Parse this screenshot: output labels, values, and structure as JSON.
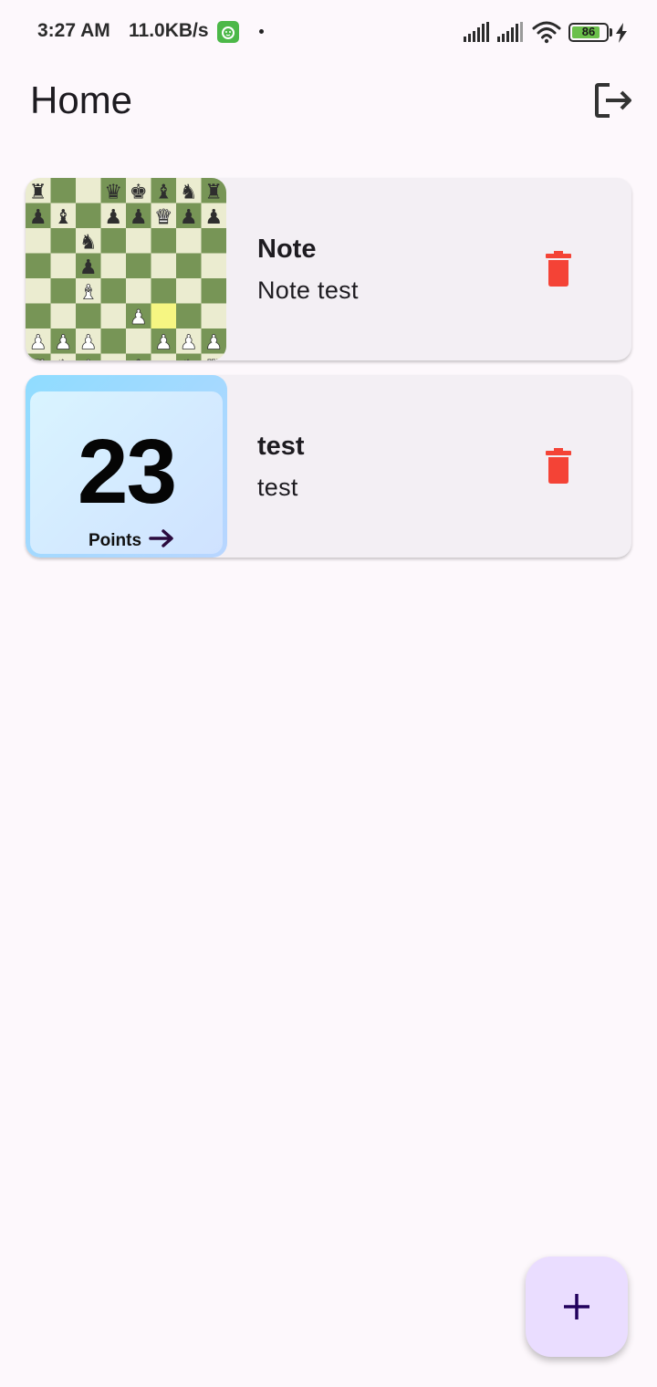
{
  "status_bar": {
    "time": "3:27 AM",
    "network_speed": "11.0KB/s",
    "battery": "86",
    "battery_level": 0.86,
    "icons": [
      "app-notification-icon",
      "dot-icon",
      "signal-icon",
      "signal-icon",
      "wifi-icon",
      "battery-icon",
      "charging-icon"
    ]
  },
  "app_bar": {
    "title": "Home",
    "logout_icon": "logout-icon"
  },
  "notes": [
    {
      "title": "Note",
      "subtitle": "Note test",
      "thumbnail": "chess-board",
      "delete_icon": "trash-icon"
    },
    {
      "title": "test",
      "subtitle": "test",
      "thumbnail": "points-card",
      "points_value": "23",
      "points_label": "Points",
      "delete_icon": "trash-icon"
    }
  ],
  "fab": {
    "icon": "plus-icon"
  },
  "colors": {
    "background": "#fdf8fc",
    "card": "#f3eff4",
    "delete": "#f44336",
    "fab": "#eaddff",
    "fab_icon": "#21005d",
    "board_dark": "#779556",
    "board_light": "#ebecd0",
    "board_highlight": "#f6f682"
  }
}
